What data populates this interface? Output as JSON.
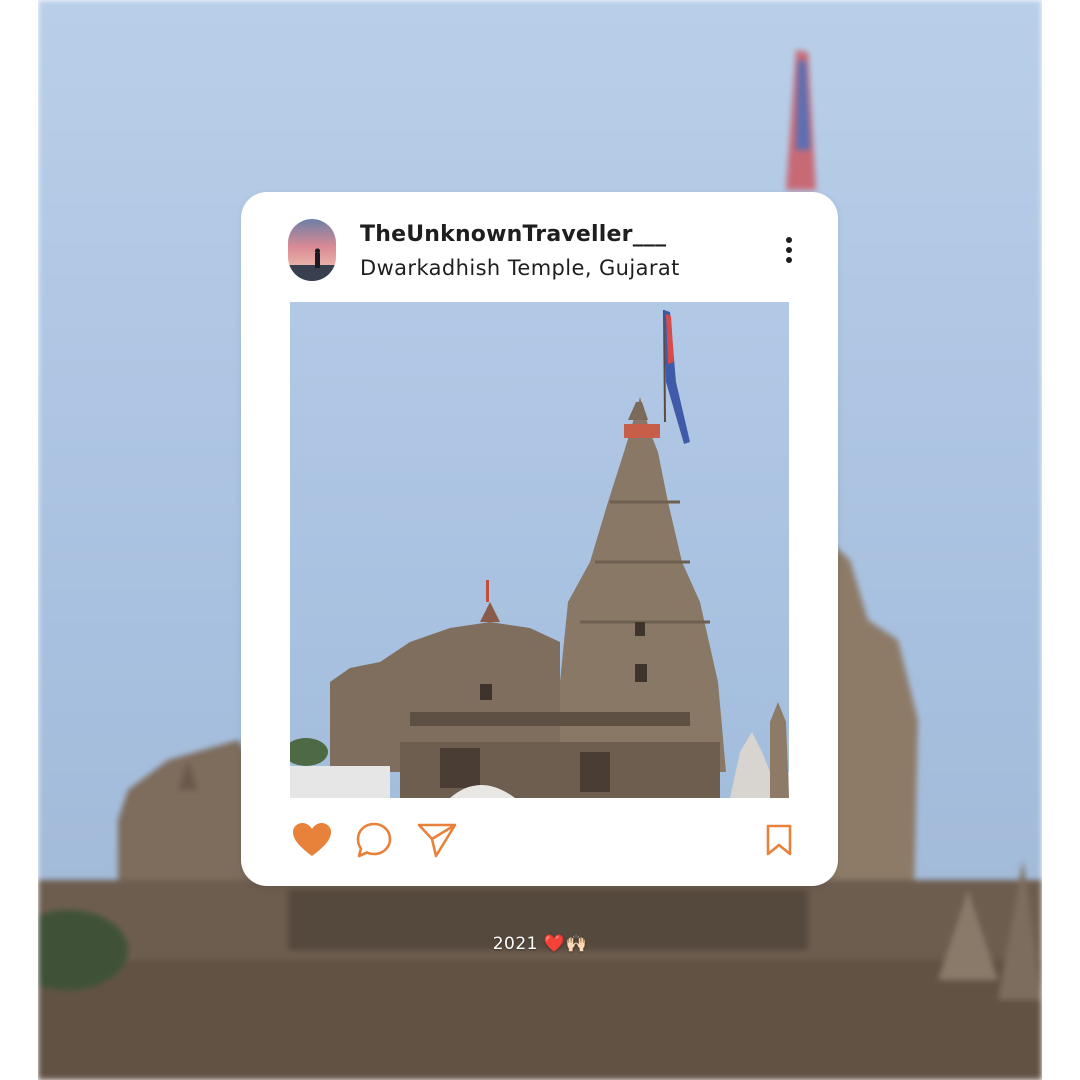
{
  "post": {
    "username": "TheUnknownTraveller___",
    "location": "Dwarkadhish Temple, Gujarat"
  },
  "caption": {
    "year": "2021",
    "heart_emoji": "❤️",
    "hands_emoji": "🙌🏻"
  },
  "icons": {
    "more": "more-vertical-icon",
    "like": "heart-icon",
    "comment": "comment-icon",
    "share": "send-icon",
    "save": "bookmark-icon"
  },
  "colors": {
    "accent": "#e8823a",
    "sky": "#a9c3e2",
    "card": "#ffffff",
    "text": "#1e1e1e"
  }
}
